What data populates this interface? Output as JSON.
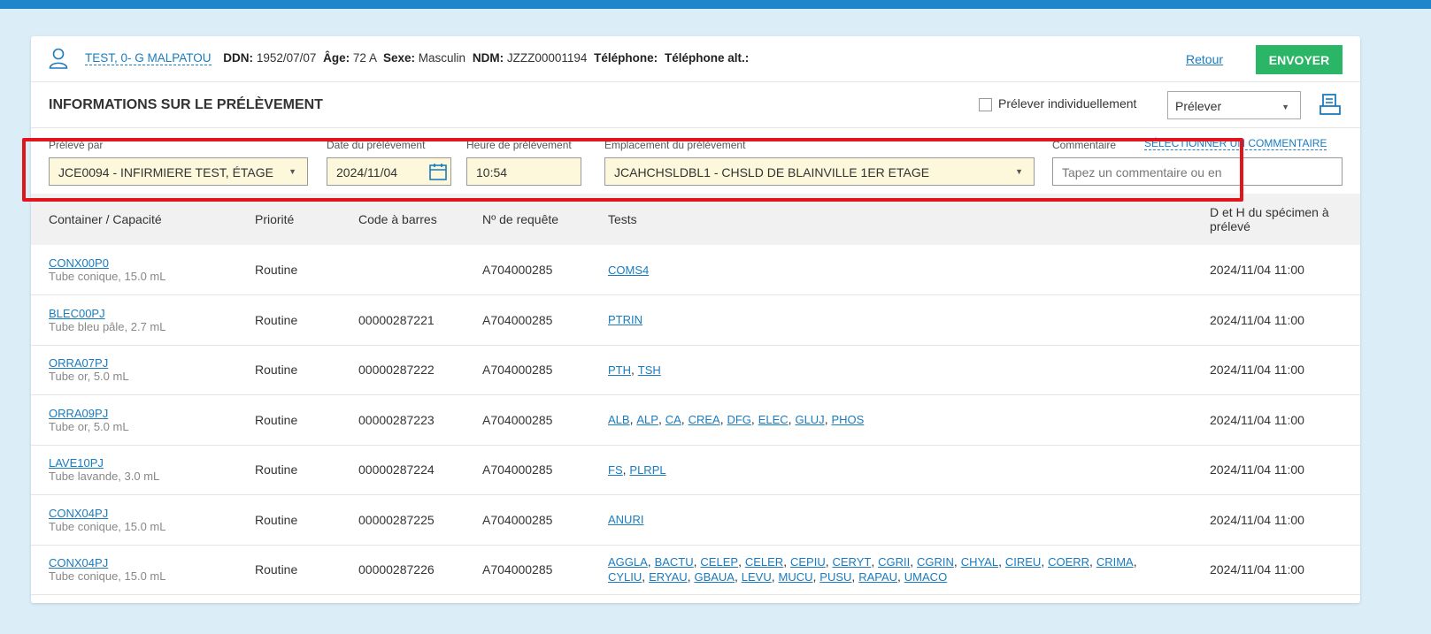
{
  "patient": {
    "name": "TEST, 0- G MALPATOU",
    "ddn_label": "DDN:",
    "ddn": "1952/07/07",
    "age_label": "Âge:",
    "age": "72 A",
    "sexe_label": "Sexe:",
    "sexe": "Masculin",
    "ndm_label": "NDM:",
    "ndm": "JZZZ00001194",
    "tel_label": "Téléphone:",
    "tel_alt_label": "Téléphone alt.:"
  },
  "actions": {
    "retour": "Retour",
    "envoyer": "ENVOYER"
  },
  "section": {
    "title": "INFORMATIONS SUR LE PRÉLÈVEMENT",
    "individual_label": "Prélever individuellement",
    "action_select": "Prélever"
  },
  "form": {
    "preleve_par_label": "Prélevé par",
    "preleve_par": "JCE0094 - INFIRMIERE TEST, ÉTAGE",
    "date_label": "Date du prélèvement",
    "date": "2024/11/04",
    "heure_label": "Heure de prélèvement",
    "heure": "10:54",
    "emplacement_label": "Emplacement du prélèvement",
    "emplacement": "JCAHCHSLDBL1 - CHSLD DE BLAINVILLE 1ER ETAGE",
    "commentaire_label": "Commentaire",
    "select_comment": "SÉLECTIONNER UN COMMENTAIRE",
    "comment_placeholder": "Tapez un commentaire ou en"
  },
  "table": {
    "headers": [
      "Container / Capacité",
      "Priorité",
      "Code à barres",
      "Nº de requête",
      "Tests",
      "D et H du spécimen à prélevé"
    ],
    "rows": [
      {
        "code": "CONX00P0",
        "desc": "Tube conique, 15.0 mL",
        "priorite": "Routine",
        "barcode": "",
        "requete": "A704000285",
        "tests": "COMS4",
        "datetime": "2024/11/04 11:00"
      },
      {
        "code": "BLEC00PJ",
        "desc": "Tube bleu pâle, 2.7 mL",
        "priorite": "Routine",
        "barcode": "00000287221",
        "requete": "A704000285",
        "tests": "PTRIN",
        "datetime": "2024/11/04 11:00"
      },
      {
        "code": "ORRA07PJ",
        "desc": "Tube or, 5.0 mL",
        "priorite": "Routine",
        "barcode": "00000287222",
        "requete": "A704000285",
        "tests": "PTH, TSH",
        "datetime": "2024/11/04 11:00"
      },
      {
        "code": "ORRA09PJ",
        "desc": "Tube or, 5.0 mL",
        "priorite": "Routine",
        "barcode": "00000287223",
        "requete": "A704000285",
        "tests": "ALB, ALP, CA, CREA, DFG, ELEC, GLUJ, PHOS",
        "datetime": "2024/11/04 11:00"
      },
      {
        "code": "LAVE10PJ",
        "desc": "Tube lavande, 3.0 mL",
        "priorite": "Routine",
        "barcode": "00000287224",
        "requete": "A704000285",
        "tests": "FS, PLRPL",
        "datetime": "2024/11/04 11:00"
      },
      {
        "code": "CONX04PJ",
        "desc": "Tube conique, 15.0 mL",
        "priorite": "Routine",
        "barcode": "00000287225",
        "requete": "A704000285",
        "tests": "ANURI",
        "datetime": "2024/11/04 11:00"
      },
      {
        "code": "CONX04PJ",
        "desc": "Tube conique, 15.0 mL",
        "priorite": "Routine",
        "barcode": "00000287226",
        "requete": "A704000285",
        "tests": "AGGLA, BACTU, CELEP, CELER, CEPIU, CERYT, CGRII, CGRIN, CHYAL, CIREU, COERR, CRIMA, CYLIU, ERYAU, GBAUA, LEVU, MUCU, PUSU, RAPAU, UMACO",
        "datetime": "2024/11/04 11:00"
      }
    ]
  }
}
